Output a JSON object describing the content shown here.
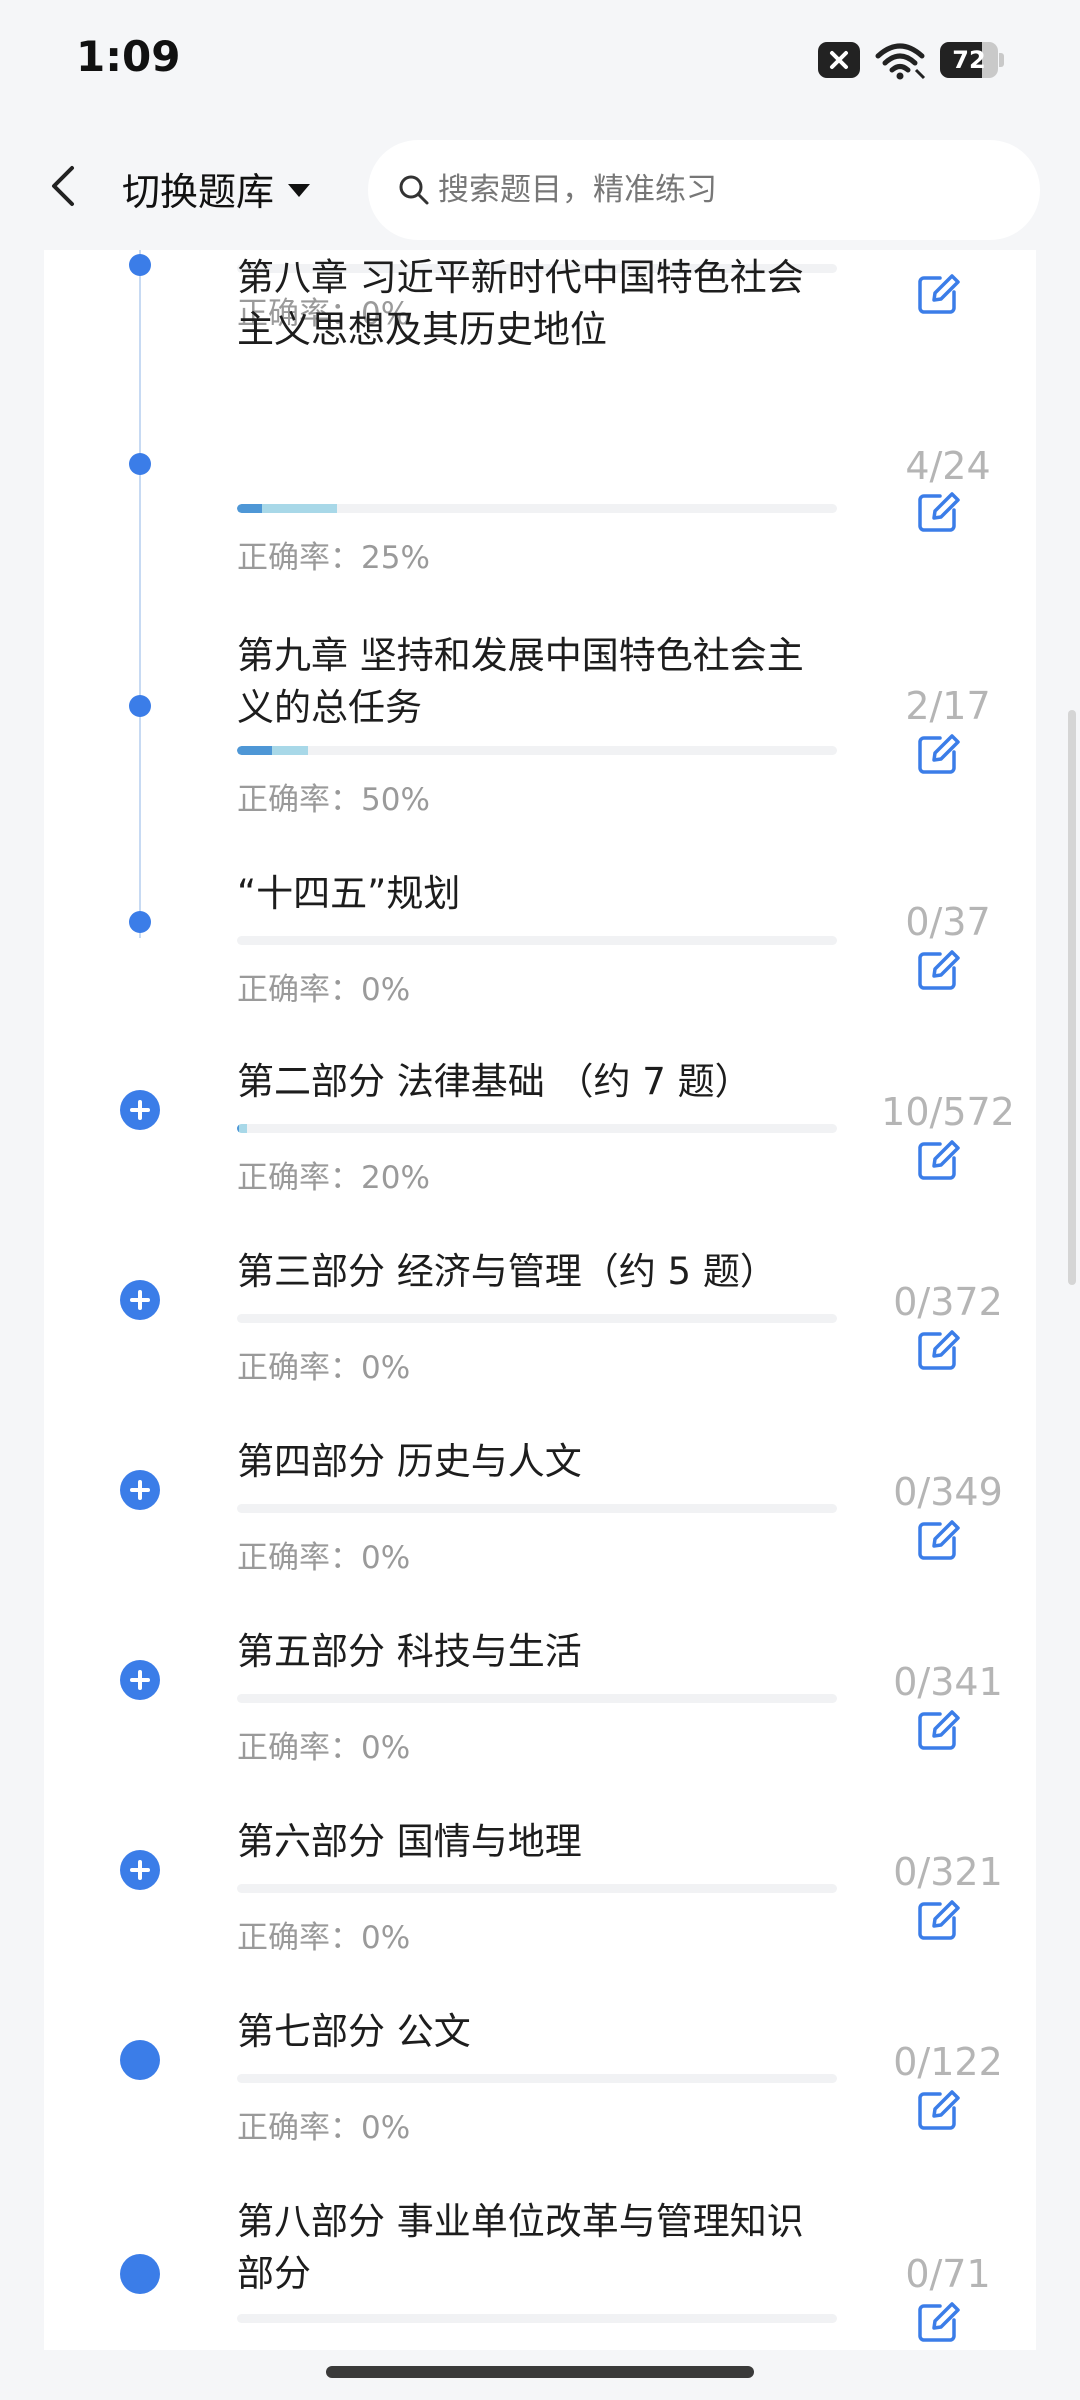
{
  "status": {
    "time": "1:09",
    "battery": 72
  },
  "header": {
    "switch_label": "切换题库",
    "search_placeholder": "搜索题目，精准练习"
  },
  "acc_prefix": "正确率：",
  "items": [
    {
      "title": "",
      "accuracy": "0%",
      "count": "",
      "done": 0,
      "total": 0,
      "node": "small"
    },
    {
      "title": "第八章 习近平新时代中国特色社会主义思想及其历史地位",
      "accuracy": "25%",
      "count": "4/24",
      "done": 4,
      "total": 24,
      "node": "small"
    },
    {
      "title": "第九章 坚持和发展中国特色社会主义的总任务",
      "accuracy": "50%",
      "count": "2/17",
      "done": 2,
      "total": 17,
      "node": "small"
    },
    {
      "title": "“十四五”规划",
      "accuracy": "0%",
      "count": "0/37",
      "done": 0,
      "total": 37,
      "node": "small"
    },
    {
      "title": "第二部分 法律基础 （约 7 题）",
      "accuracy": "20%",
      "count": "10/572",
      "done": 10,
      "total": 572,
      "node": "plus"
    },
    {
      "title": "第三部分 经济与管理（约 5 题）",
      "accuracy": "0%",
      "count": "0/372",
      "done": 0,
      "total": 372,
      "node": "plus"
    },
    {
      "title": "第四部分 历史与人文",
      "accuracy": "0%",
      "count": "0/349",
      "done": 0,
      "total": 349,
      "node": "plus"
    },
    {
      "title": "第五部分 科技与生活",
      "accuracy": "0%",
      "count": "0/341",
      "done": 0,
      "total": 341,
      "node": "plus"
    },
    {
      "title": "第六部分 国情与地理",
      "accuracy": "0%",
      "count": "0/321",
      "done": 0,
      "total": 321,
      "node": "plus"
    },
    {
      "title": "第七部分 公文",
      "accuracy": "0%",
      "count": "0/122",
      "done": 0,
      "total": 122,
      "node": "big"
    },
    {
      "title": "第八部分 事业单位改革与管理知识部分",
      "accuracy": "0%",
      "count": "0/71",
      "done": 0,
      "total": 71,
      "node": "big"
    }
  ],
  "colors": {
    "accent": "#3b7de8",
    "bar_done": "#4e97d6",
    "bar_correct": "#a8d8e8"
  }
}
